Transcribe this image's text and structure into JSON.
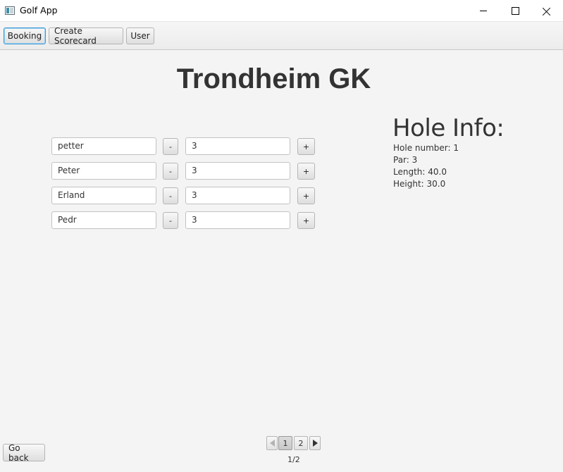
{
  "window": {
    "title": "Golf App",
    "icon": "app-window-icon"
  },
  "toolbar": {
    "booking_label": "Booking",
    "create_scorecard_label": "Create Scorecard",
    "user_label": "User"
  },
  "main": {
    "course_name": "Trondheim GK",
    "players": [
      {
        "name": "petter",
        "score": "3",
        "minus_label": "-",
        "plus_label": "+"
      },
      {
        "name": "Peter",
        "score": "3",
        "minus_label": "-",
        "plus_label": "+"
      },
      {
        "name": "Erland",
        "score": "3",
        "minus_label": "-",
        "plus_label": "+"
      },
      {
        "name": "Pedr",
        "score": "3",
        "minus_label": "-",
        "plus_label": "+"
      }
    ]
  },
  "hole_info": {
    "title": "Hole Info:",
    "hole_number": "Hole number: 1",
    "par": "Par: 3",
    "length": "Length: 40.0",
    "height": "Height: 30.0"
  },
  "pagination": {
    "pages": [
      "1",
      "2"
    ],
    "current_page": 1,
    "label": "1/2"
  },
  "footer": {
    "go_back_label": "Go back"
  }
}
